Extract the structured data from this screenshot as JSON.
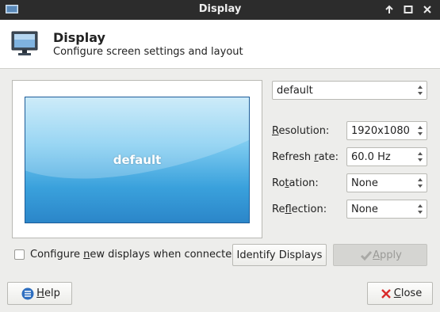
{
  "window": {
    "title": "Display",
    "controls": [
      "maximize-up-icon",
      "restore-icon",
      "close-icon"
    ]
  },
  "header": {
    "icon": "monitor-icon",
    "title": "Display",
    "subtitle": "Configure screen settings and layout"
  },
  "preview": {
    "monitor_label": "default"
  },
  "display_select": {
    "value": "default"
  },
  "settings": {
    "resolution": {
      "label_pre": "",
      "label_u": "R",
      "label_post": "esolution:",
      "value": "1920x1080"
    },
    "refresh_rate": {
      "label_pre": "Refresh ",
      "label_u": "r",
      "label_post": "ate:",
      "value": "60.0 Hz"
    },
    "rotation": {
      "label_pre": "Ro",
      "label_u": "t",
      "label_post": "ation:",
      "value": "None"
    },
    "reflection": {
      "label_pre": "Re",
      "label_u": "f",
      "label_post": "lection:",
      "value": "None"
    }
  },
  "configure_new": {
    "checked": false,
    "label_pre": "Configure ",
    "label_u": "n",
    "label_post": "ew displays when connected"
  },
  "buttons": {
    "identify": "Identify Displays",
    "apply_u": "A",
    "apply_post": "pply",
    "help_u": "H",
    "help_post": "elp",
    "close_u": "C",
    "close_post": "lose"
  },
  "colors": {
    "titlebar": "#2c2c2c",
    "monitor_top": "#bfe6f8",
    "monitor_bottom": "#2b86c9",
    "close_red": "#d92b2b",
    "help_blue": "#2f6fc0"
  }
}
